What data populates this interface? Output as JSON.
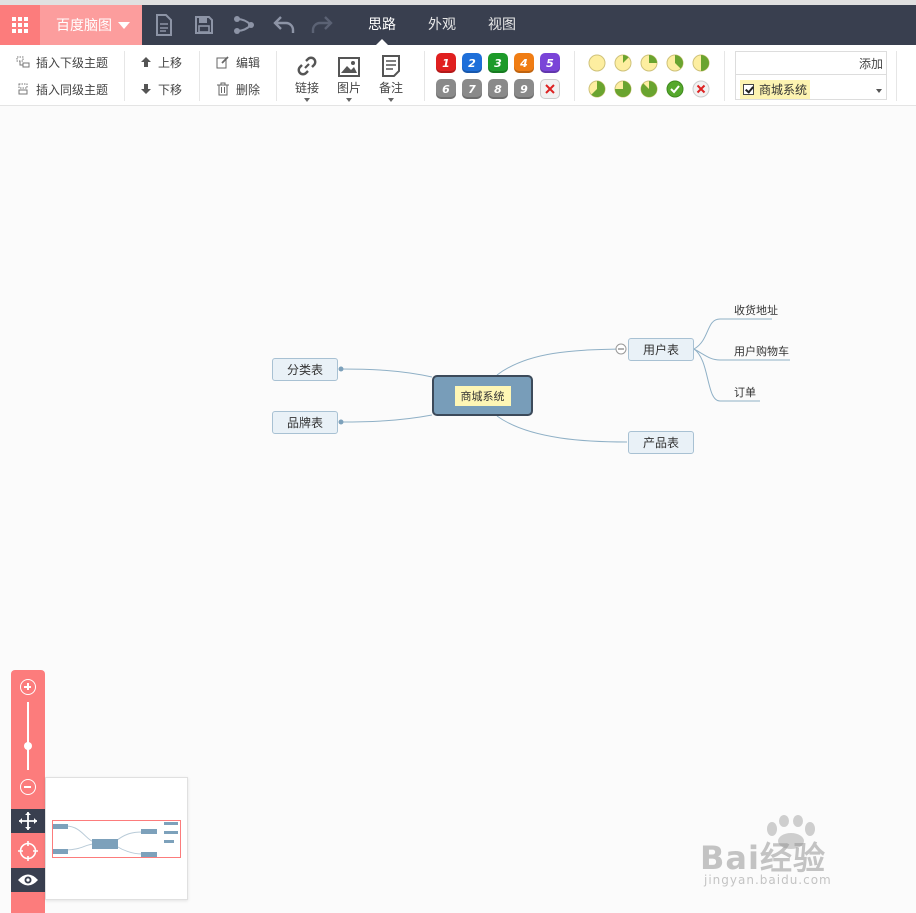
{
  "topbar": {
    "app_name": "百度脑图",
    "icons": [
      "apps-grid-icon",
      "new-file-icon",
      "save-icon",
      "share-icon",
      "undo-icon",
      "redo-icon"
    ],
    "tabs": [
      {
        "label": "思路",
        "active": true
      },
      {
        "label": "外观",
        "active": false
      },
      {
        "label": "视图",
        "active": false
      }
    ]
  },
  "toolbar": {
    "insert_child": "插入下级主题",
    "insert_sibling": "插入同级主题",
    "move_up": "上移",
    "move_down": "下移",
    "edit": "编辑",
    "delete": "删除",
    "link": "链接",
    "image": "图片",
    "note": "备注",
    "priorities": [
      "1",
      "2",
      "3",
      "4",
      "5",
      "6",
      "7",
      "8",
      "9"
    ],
    "priority_colors": [
      "#e02020",
      "#1e6fd9",
      "#1d9a2a",
      "#f07d14",
      "#7a44d8",
      "#8a8a8a",
      "#8a8a8a",
      "#8a8a8a",
      "#8a8a8a"
    ],
    "progress_levels": [
      0,
      0.125,
      0.25,
      0.375,
      0.5,
      0.625,
      0.75,
      0.875,
      1
    ],
    "tag_add": "添加",
    "tag_selected": "商城系统"
  },
  "mindmap": {
    "root": "商城系统",
    "left": [
      "分类表",
      "品牌表"
    ],
    "right": [
      {
        "label": "用户表",
        "children": [
          "收货地址",
          "用户购物车",
          "订单"
        ]
      },
      {
        "label": "产品表",
        "children": []
      }
    ]
  },
  "watermark": {
    "brand": "Bai经验",
    "url": "jingyan.baidu.com"
  },
  "colors": {
    "accent": "#fc7c7c",
    "topbar": "#393f4f",
    "node_fill": "#e9f1f7",
    "root_fill": "#789db9",
    "link": "#8fb0c6"
  }
}
